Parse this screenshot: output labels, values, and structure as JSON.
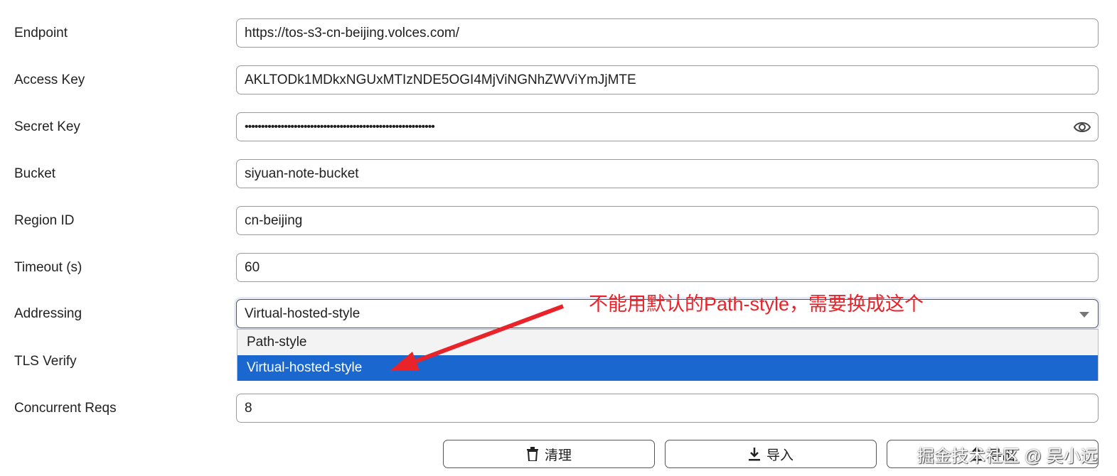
{
  "fields": [
    {
      "label": "Endpoint",
      "value": "https://tos-s3-cn-beijing.volces.com/"
    },
    {
      "label": "Access Key",
      "value": "AKLTODk1MDkxNGUxMTIzNDE5OGI4MjViNGNhZWViYmJjMTE"
    },
    {
      "label": "Secret Key",
      "value": "••••••••••••••••••••••••••••••••••••••••••••••••••••••••••"
    },
    {
      "label": "Bucket",
      "value": "siyuan-note-bucket"
    },
    {
      "label": "Region ID",
      "value": "cn-beijing"
    },
    {
      "label": "Timeout (s)",
      "value": "60"
    },
    {
      "label": "Addressing",
      "value": "Virtual-hosted-style"
    },
    {
      "label": "TLS Verify"
    },
    {
      "label": "Concurrent Reqs",
      "value": "8"
    }
  ],
  "dropdown": {
    "options": [
      "Path-style",
      "Virtual-hosted-style"
    ],
    "selected": "Virtual-hosted-style"
  },
  "buttons": {
    "clean": "清理",
    "import": "导入",
    "export": "导出"
  },
  "annotation": "不能用默认的Path-style，需要换成这个",
  "watermark": "掘金技术社区 @ 吴小远",
  "colors": {
    "selected": "#1a67d0",
    "annotation": "#e8232a"
  }
}
